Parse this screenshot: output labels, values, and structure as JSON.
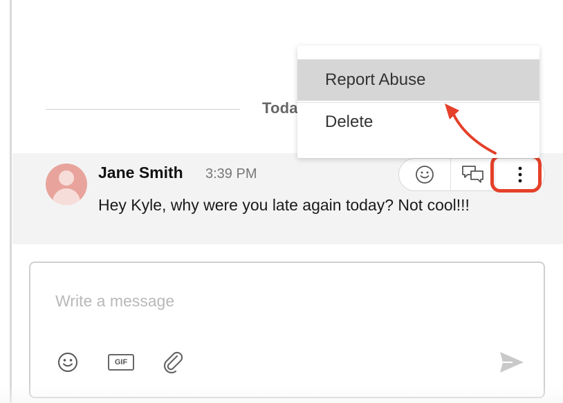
{
  "divider": {
    "label": "Toda"
  },
  "message": {
    "author": "Jane Smith",
    "time": "3:39 PM",
    "text": "Hey Kyle, why were you late again today? Not cool!!!"
  },
  "menu": {
    "items": [
      {
        "label": "Report Abuse",
        "state": "hovered"
      },
      {
        "label": "Delete"
      }
    ]
  },
  "actions": {
    "icons": [
      "emoji-icon",
      "reply-thread-icon",
      "more-options-icon"
    ]
  },
  "composer": {
    "placeholder": "Write a message",
    "value": "",
    "gif_label": "GIF",
    "tools": [
      "emoji-icon",
      "gif-icon",
      "attachment-icon",
      "send-icon"
    ]
  },
  "colors": {
    "highlight": "#e5402a",
    "message_bg": "#f3f3f3",
    "menu_hover": "#d6d6d6",
    "avatar": "#e8a49c"
  }
}
